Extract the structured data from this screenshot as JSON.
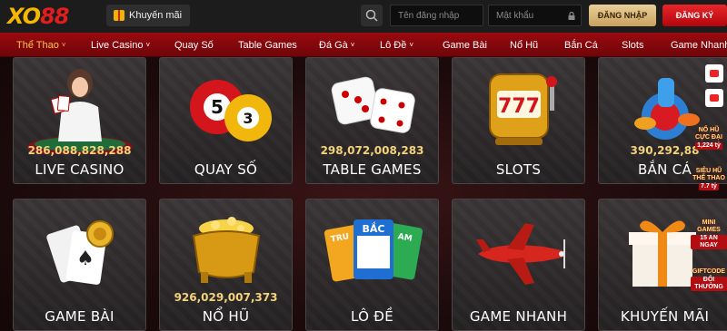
{
  "header": {
    "logo_part_a": "XO",
    "logo_part_b": "88",
    "promo_label": "Khuyến mãi",
    "username_placeholder": "Tên đăng nhập",
    "password_placeholder": "Mật khẩu",
    "login_label": "ĐĂNG NHẬP",
    "register_label": "ĐĂNG KÝ"
  },
  "nav": {
    "items": [
      {
        "label": "Thể Thao",
        "has_dropdown": true,
        "active": true
      },
      {
        "label": "Live Casino",
        "has_dropdown": true,
        "active": false
      },
      {
        "label": "Quay Số",
        "has_dropdown": false,
        "active": false
      },
      {
        "label": "Table Games",
        "has_dropdown": false,
        "active": false
      },
      {
        "label": "Đá Gà",
        "has_dropdown": true,
        "active": false
      },
      {
        "label": "Lô Đề",
        "has_dropdown": true,
        "active": false
      },
      {
        "label": "Game Bài",
        "has_dropdown": false,
        "active": false
      },
      {
        "label": "Nổ Hũ",
        "has_dropdown": false,
        "active": false
      },
      {
        "label": "Bắn Cá",
        "has_dropdown": false,
        "active": false
      },
      {
        "label": "Slots",
        "has_dropdown": false,
        "active": false
      },
      {
        "label": "Game Nhanh",
        "has_dropdown": false,
        "active": false
      }
    ],
    "dropdown_glyph": "˅"
  },
  "cards": [
    {
      "title": "LIVE CASINO",
      "jackpot": "286,088,828,288"
    },
    {
      "title": "QUAY SỐ",
      "jackpot": ""
    },
    {
      "title": "TABLE GAMES",
      "jackpot": "298,072,008,283"
    },
    {
      "title": "SLOTS",
      "jackpot": ""
    },
    {
      "title": "BẮN CÁ",
      "jackpot": "390,292,88"
    },
    {
      "title": "GAME BÀI",
      "jackpot": ""
    },
    {
      "title": "NỔ HŨ",
      "jackpot": "926,029,007,373"
    },
    {
      "title": "LÔ ĐỀ",
      "jackpot": ""
    },
    {
      "title": "GAME NHANH",
      "jackpot": ""
    },
    {
      "title": "KHUYẾN MÃI",
      "jackpot": ""
    }
  ],
  "art_text": {
    "ball_5": "5",
    "ball_3": "3",
    "slot_777": "777",
    "ticket_1": "TRU",
    "ticket_2": "BẮC",
    "ticket_3": "AM"
  },
  "side_promos": [
    {
      "label": "NỔ HŨ CỰC ĐẠI",
      "value": "1,224 tỷ"
    },
    {
      "label": "SIÊU HŨ THỂ THAO",
      "value": "7.7 tỷ"
    },
    {
      "label": "MINI GAMES",
      "value": "15 AN NGAY"
    },
    {
      "label": "GIFTCODE",
      "value": "ĐỔI THƯỞNG"
    }
  ],
  "colors": {
    "brand_red": "#b3060d",
    "brand_gold": "#f5b800",
    "nav_active": "#f5c74a"
  }
}
